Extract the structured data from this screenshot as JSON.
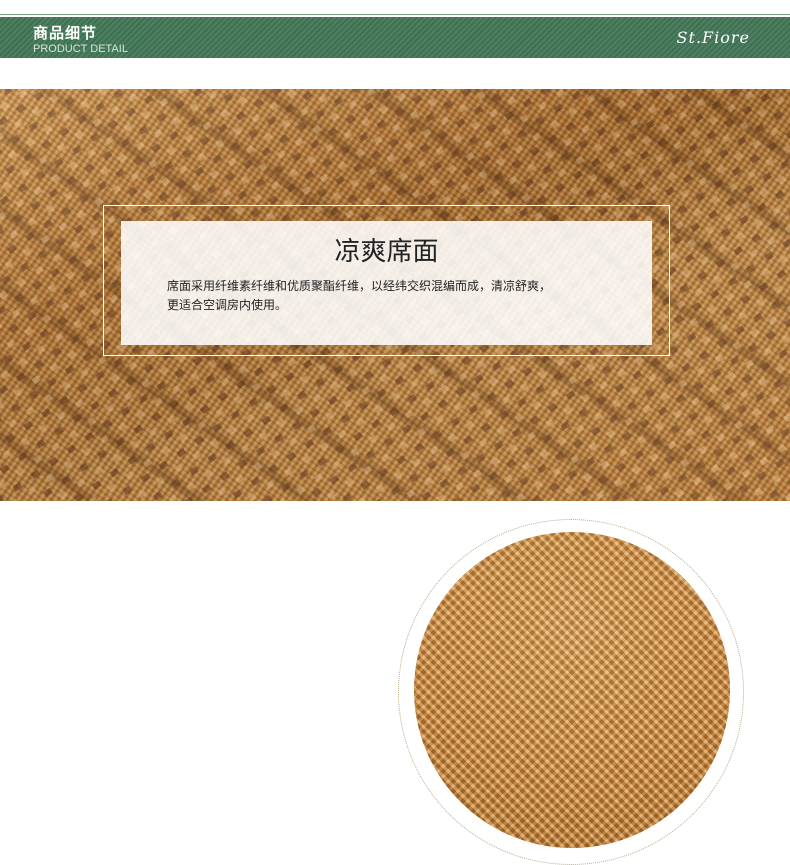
{
  "header": {
    "title_cn": "商品细节",
    "title_en": "PRODUCT DETAIL",
    "brand": "St.Fiore",
    "accent_color": "#4d8060"
  },
  "feature": {
    "title": "凉爽席面",
    "description_line1": "席面采用纤维素纤维和优质聚酯纤维，以经纬交织混编而成，清凉舒爽，",
    "description_line2": "更适合空调房内使用。"
  },
  "images": {
    "woven_texture": "woven-mat-closeup-photo",
    "mesh_detail": "mesh-fabric-circle-photo"
  }
}
